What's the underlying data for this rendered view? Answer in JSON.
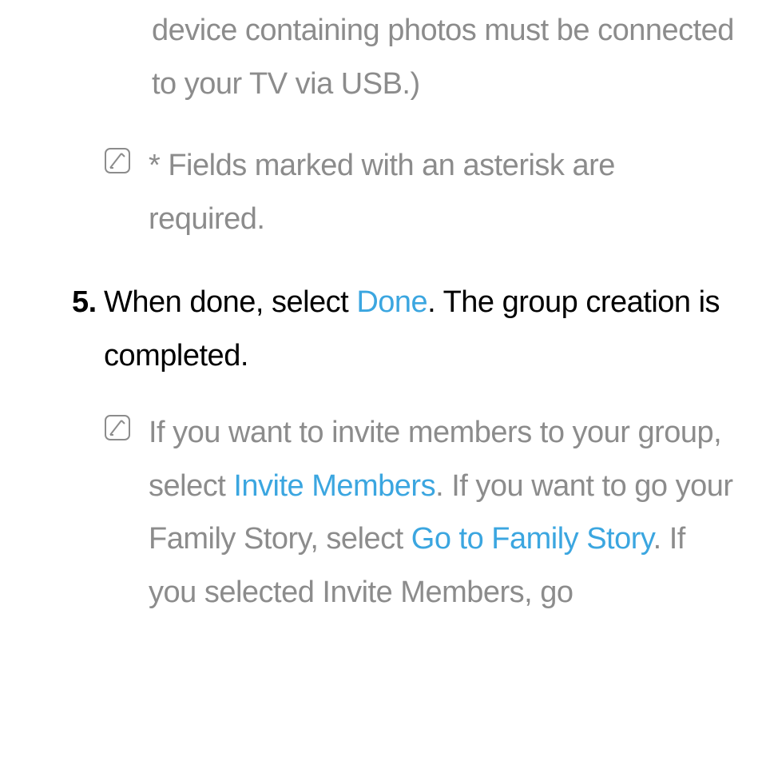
{
  "colors": {
    "gray": "#8c8c8c",
    "black": "#000000",
    "link_blue": "#3ba6e0"
  },
  "fragment_top": {
    "text": "device containing photos must be connected to your TV via USB.)"
  },
  "note_1": {
    "text": "* Fields marked with an asterisk are required."
  },
  "step_5": {
    "number": "5.",
    "pre": "When done, select ",
    "done": "Done",
    "post": ". The group creation is completed."
  },
  "note_2": {
    "seg1": "If you want to invite members to your group, select ",
    "invite": "Invite Members",
    "seg2": ". If you want to go your Family Story, select ",
    "goto": "Go to Family Story",
    "seg3": ". If you selected Invite Members, go"
  }
}
